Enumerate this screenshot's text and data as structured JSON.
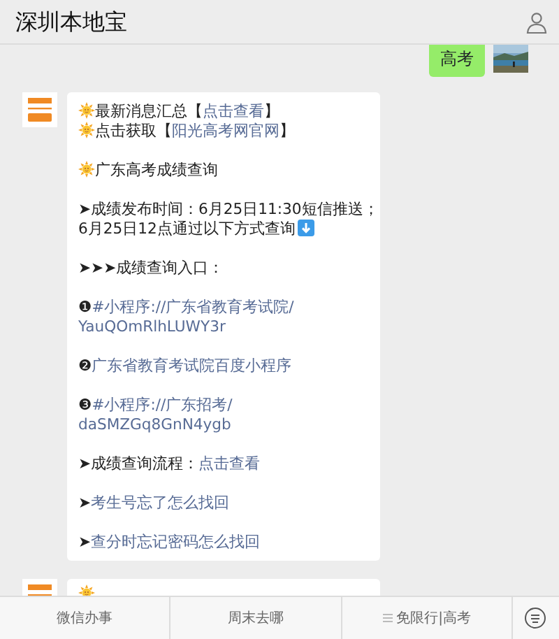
{
  "header": {
    "title": "深圳本地宝"
  },
  "sent": {
    "text": "高考"
  },
  "message": {
    "blocks": [
      [
        {
          "kind": "emoji",
          "lines": [
            [
              {
                "text": "最新消息汇总【",
                "link": false
              },
              {
                "text": "点击查看",
                "link": true
              },
              {
                "text": "】",
                "link": false
              }
            ]
          ]
        },
        {
          "kind": "emoji",
          "lines": [
            [
              {
                "text": "点击获取【",
                "link": false
              },
              {
                "text": "阳光高考网官网",
                "link": true
              },
              {
                "text": "】",
                "link": false
              }
            ]
          ]
        }
      ],
      [
        {
          "kind": "emoji",
          "lines": [
            [
              {
                "text": "广东高考成绩查询",
                "link": false
              }
            ]
          ]
        }
      ],
      [
        {
          "kind": "arrow",
          "lines": [
            [
              {
                "text": "➤成绩发布时间：6月25日11:30短信推送；",
                "link": false
              }
            ],
            [
              {
                "text": "6月25日12点通过以下方式查询",
                "link": false
              }
            ]
          ]
        }
      ],
      [
        {
          "kind": "plain",
          "lines": [
            [
              {
                "text": "➤➤➤成绩查询入口：",
                "link": false
              }
            ]
          ]
        }
      ],
      [
        {
          "kind": "plain",
          "lines": [
            [
              {
                "text": "❶",
                "link": false
              },
              {
                "text": "#小程序://广东省教育考试院/",
                "link": true
              }
            ],
            [
              {
                "text": "YauQOmRlhLUWY3r",
                "link": true
              }
            ]
          ]
        }
      ],
      [
        {
          "kind": "plain",
          "lines": [
            [
              {
                "text": "❷",
                "link": false
              },
              {
                "text": "广东省教育考试院百度小程序",
                "link": true
              }
            ]
          ]
        }
      ],
      [
        {
          "kind": "plain",
          "lines": [
            [
              {
                "text": "❸",
                "link": false
              },
              {
                "text": "#小程序://广东招考/",
                "link": true
              }
            ],
            [
              {
                "text": "daSMZGq8GnN4ygb",
                "link": true
              }
            ]
          ]
        }
      ],
      [
        {
          "kind": "plain",
          "lines": [
            [
              {
                "text": "➤成绩查询流程：",
                "link": false
              },
              {
                "text": "点击查看",
                "link": true
              }
            ]
          ]
        }
      ],
      [
        {
          "kind": "plain",
          "lines": [
            [
              {
                "text": "➤",
                "link": false
              },
              {
                "text": "考生号忘了怎么找回",
                "link": true
              }
            ]
          ]
        }
      ],
      [
        {
          "kind": "plain",
          "lines": [
            [
              {
                "text": "➤",
                "link": false
              },
              {
                "text": "查分时忘记密码怎么找回",
                "link": true
              }
            ]
          ]
        }
      ]
    ]
  },
  "next_message": {
    "kind": "emoji"
  },
  "menu": [
    {
      "label": "微信办事",
      "submenu": false
    },
    {
      "label": "周末去哪",
      "submenu": false
    },
    {
      "label": "免限行|高考",
      "submenu": true
    }
  ]
}
